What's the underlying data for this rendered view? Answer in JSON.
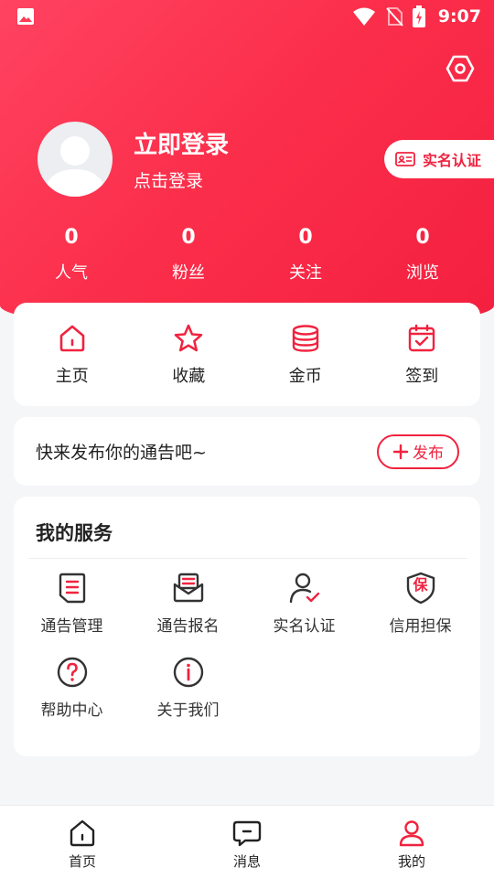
{
  "status_bar": {
    "time": "9:07"
  },
  "profile": {
    "title": "立即登录",
    "subtitle": "点击登录",
    "verify_label": "实名认证"
  },
  "stats": [
    {
      "value": "0",
      "label": "人气"
    },
    {
      "value": "0",
      "label": "粉丝"
    },
    {
      "value": "0",
      "label": "关注"
    },
    {
      "value": "0",
      "label": "浏览"
    }
  ],
  "quick_actions": [
    {
      "label": "主页",
      "icon": "home-icon"
    },
    {
      "label": "收藏",
      "icon": "star-icon"
    },
    {
      "label": "金币",
      "icon": "coins-icon"
    },
    {
      "label": "签到",
      "icon": "calendar-check-icon"
    }
  ],
  "publish": {
    "text": "快来发布你的通告吧~",
    "button_label": "发布"
  },
  "services": {
    "title": "我的服务",
    "items": [
      {
        "label": "通告管理",
        "icon": "document-list-icon"
      },
      {
        "label": "通告报名",
        "icon": "envelope-icon"
      },
      {
        "label": "实名认证",
        "icon": "user-check-icon"
      },
      {
        "label": "信用担保",
        "icon": "shield-bao-icon",
        "icon_text": "保"
      },
      {
        "label": "帮助中心",
        "icon": "help-circle-icon"
      },
      {
        "label": "关于我们",
        "icon": "info-circle-icon"
      }
    ]
  },
  "tabbar": [
    {
      "label": "首页",
      "icon": "home-icon"
    },
    {
      "label": "消息",
      "icon": "message-icon"
    },
    {
      "label": "我的",
      "icon": "user-icon",
      "active": true
    }
  ],
  "colors": {
    "brand": "#f0233f",
    "header_start": "#ff4361",
    "header_end": "#f41f3f"
  }
}
